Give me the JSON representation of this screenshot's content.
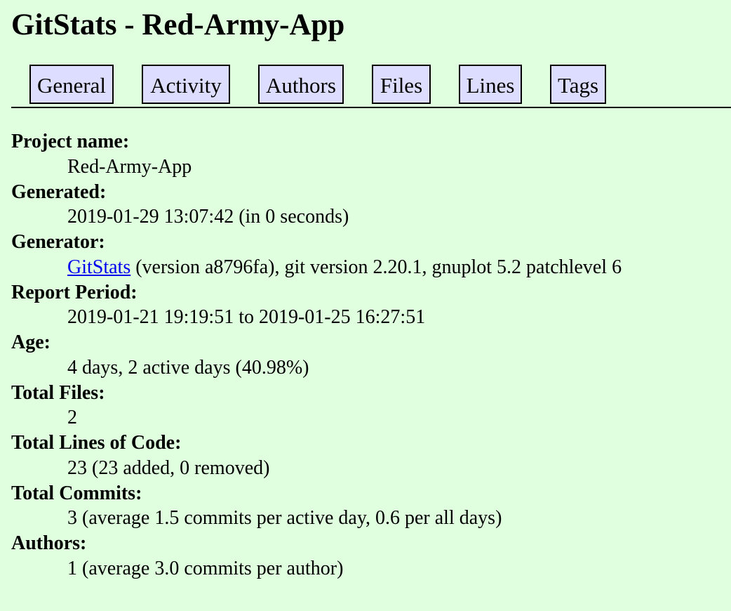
{
  "page": {
    "title": "GitStats - Red-Army-App",
    "background": "#dfffdf"
  },
  "nav": {
    "accent": "#ddddff",
    "tabs": [
      {
        "label": "General"
      },
      {
        "label": "Activity"
      },
      {
        "label": "Authors"
      },
      {
        "label": "Files"
      },
      {
        "label": "Lines"
      },
      {
        "label": "Tags"
      }
    ]
  },
  "general": {
    "project_name": {
      "label": "Project name:",
      "value": "Red-Army-App"
    },
    "generated": {
      "label": "Generated:",
      "value": "2019-01-29 13:07:42 (in 0 seconds)"
    },
    "generator": {
      "label": "Generator:",
      "link_text": "GitStats",
      "value_rest": " (version a8796fa), git version 2.20.1, gnuplot 5.2 patchlevel 6",
      "link_color": "#0000ee"
    },
    "report_period": {
      "label": "Report Period:",
      "value": "2019-01-21 19:19:51 to 2019-01-25 16:27:51"
    },
    "age": {
      "label": "Age:",
      "value": "4 days, 2 active days (40.98%)"
    },
    "total_files": {
      "label": "Total Files:",
      "value": "2"
    },
    "total_lines": {
      "label": "Total Lines of Code:",
      "value": "23 (23 added, 0 removed)"
    },
    "total_commits": {
      "label": "Total Commits:",
      "value": "3 (average 1.5 commits per active day, 0.6 per all days)"
    },
    "authors": {
      "label": "Authors:",
      "value": "1 (average 3.0 commits per author)"
    }
  }
}
